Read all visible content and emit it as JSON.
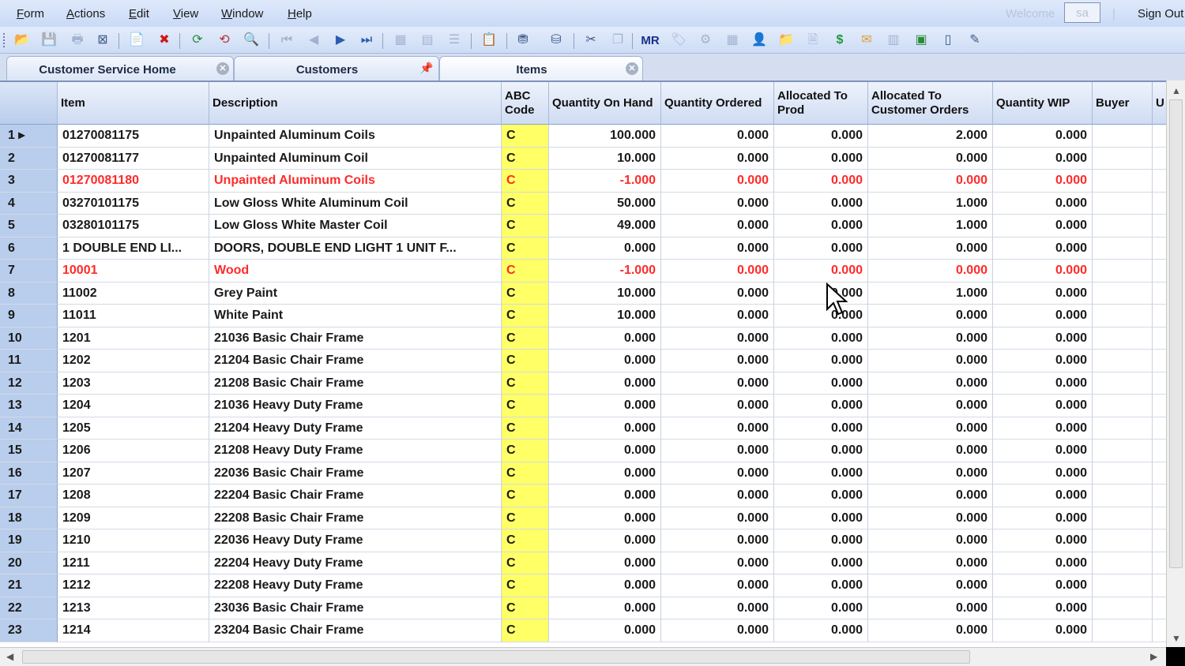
{
  "menu": [
    {
      "first": "F",
      "rest": "orm"
    },
    {
      "first": "A",
      "rest": "ctions"
    },
    {
      "first": "E",
      "rest": "dit"
    },
    {
      "first": "V",
      "rest": "iew"
    },
    {
      "first": "W",
      "rest": "indow"
    },
    {
      "first": "H",
      "rest": "elp"
    }
  ],
  "header": {
    "welcome": "Welcome",
    "user": "sa",
    "separator": "|",
    "sign_out": "Sign Out"
  },
  "toolbar_icons": [
    "open-folder-icon",
    "save-icon",
    "print-icon",
    "close-form-icon",
    "new-icon",
    "delete-icon",
    "refresh-icon",
    "refresh-current-icon",
    "find-icon",
    "first-record-icon",
    "prev-record-icon",
    "next-record-icon",
    "last-record-icon",
    "grid-view-icon",
    "form-view-icon",
    "list-view-icon",
    "report-icon",
    "filter-icon",
    "filter-in-place-icon",
    "tools-icon",
    "copy-icon",
    "mr-icon",
    "tag-icon",
    "gear-icon",
    "calculator-icon",
    "user-icon",
    "folder-icon",
    "document-icon",
    "dollar-icon",
    "mail-icon",
    "table-icon",
    "excel-icon",
    "blank-page-icon",
    "stamp-icon"
  ],
  "tabs": [
    {
      "label": "Customer Service Home"
    },
    {
      "label": "Customers"
    },
    {
      "label": "Items"
    }
  ],
  "columns": [
    "",
    "Item",
    "Description",
    "ABC Code",
    "Quantity On Hand",
    "Quantity Ordered",
    "Allocated To Prod",
    "Allocated To Customer Orders",
    "Quantity WIP",
    "Buyer",
    "U"
  ],
  "rows": [
    {
      "n": "1 ▸",
      "item": "01270081175",
      "desc": "Unpainted Aluminum Coils",
      "abc": "C",
      "qoh": "100.000",
      "qord": "0.000",
      "aprod": "0.000",
      "acust": "2.000",
      "wip": "0.000",
      "buyer": "",
      "red": false
    },
    {
      "n": "2",
      "item": "01270081177",
      "desc": "Unpainted Aluminum Coil",
      "abc": "C",
      "qoh": "10.000",
      "qord": "0.000",
      "aprod": "0.000",
      "acust": "0.000",
      "wip": "0.000",
      "buyer": "",
      "red": false
    },
    {
      "n": "3",
      "item": "01270081180",
      "desc": "Unpainted Aluminum Coils",
      "abc": "C",
      "qoh": "-1.000",
      "qord": "0.000",
      "aprod": "0.000",
      "acust": "0.000",
      "wip": "0.000",
      "buyer": "",
      "red": true
    },
    {
      "n": "4",
      "item": "03270101175",
      "desc": "Low Gloss White Aluminum Coil",
      "abc": "C",
      "qoh": "50.000",
      "qord": "0.000",
      "aprod": "0.000",
      "acust": "1.000",
      "wip": "0.000",
      "buyer": "",
      "red": false
    },
    {
      "n": "5",
      "item": "03280101175",
      "desc": "Low Gloss White Master Coil",
      "abc": "C",
      "qoh": "49.000",
      "qord": "0.000",
      "aprod": "0.000",
      "acust": "1.000",
      "wip": "0.000",
      "buyer": "",
      "red": false
    },
    {
      "n": "6",
      "item": "1 DOUBLE END LI...",
      "desc": "DOORS, DOUBLE END LIGHT 1 UNIT F...",
      "abc": "C",
      "qoh": "0.000",
      "qord": "0.000",
      "aprod": "0.000",
      "acust": "0.000",
      "wip": "0.000",
      "buyer": "",
      "red": false
    },
    {
      "n": "7",
      "item": "10001",
      "desc": "Wood",
      "abc": "C",
      "qoh": "-1.000",
      "qord": "0.000",
      "aprod": "0.000",
      "acust": "0.000",
      "wip": "0.000",
      "buyer": "",
      "red": true
    },
    {
      "n": "8",
      "item": "11002",
      "desc": "Grey Paint",
      "abc": "C",
      "qoh": "10.000",
      "qord": "0.000",
      "aprod": "0.000",
      "acust": "1.000",
      "wip": "0.000",
      "buyer": "",
      "red": false
    },
    {
      "n": "9",
      "item": "11011",
      "desc": "White Paint",
      "abc": "C",
      "qoh": "10.000",
      "qord": "0.000",
      "aprod": "0.000",
      "acust": "0.000",
      "wip": "0.000",
      "buyer": "",
      "red": false
    },
    {
      "n": "10",
      "item": "1201",
      "desc": "21036 Basic Chair Frame",
      "abc": "C",
      "qoh": "0.000",
      "qord": "0.000",
      "aprod": "0.000",
      "acust": "0.000",
      "wip": "0.000",
      "buyer": "",
      "red": false
    },
    {
      "n": "11",
      "item": "1202",
      "desc": "21204 Basic Chair Frame",
      "abc": "C",
      "qoh": "0.000",
      "qord": "0.000",
      "aprod": "0.000",
      "acust": "0.000",
      "wip": "0.000",
      "buyer": "",
      "red": false
    },
    {
      "n": "12",
      "item": "1203",
      "desc": "21208 Basic Chair Frame",
      "abc": "C",
      "qoh": "0.000",
      "qord": "0.000",
      "aprod": "0.000",
      "acust": "0.000",
      "wip": "0.000",
      "buyer": "",
      "red": false
    },
    {
      "n": "13",
      "item": "1204",
      "desc": "21036 Heavy Duty  Frame",
      "abc": "C",
      "qoh": "0.000",
      "qord": "0.000",
      "aprod": "0.000",
      "acust": "0.000",
      "wip": "0.000",
      "buyer": "",
      "red": false
    },
    {
      "n": "14",
      "item": "1205",
      "desc": "21204 Heavy Duty Frame",
      "abc": "C",
      "qoh": "0.000",
      "qord": "0.000",
      "aprod": "0.000",
      "acust": "0.000",
      "wip": "0.000",
      "buyer": "",
      "red": false
    },
    {
      "n": "15",
      "item": "1206",
      "desc": "21208 Heavy Duty Frame",
      "abc": "C",
      "qoh": "0.000",
      "qord": "0.000",
      "aprod": "0.000",
      "acust": "0.000",
      "wip": "0.000",
      "buyer": "",
      "red": false
    },
    {
      "n": "16",
      "item": "1207",
      "desc": "22036 Basic Chair Frame",
      "abc": "C",
      "qoh": "0.000",
      "qord": "0.000",
      "aprod": "0.000",
      "acust": "0.000",
      "wip": "0.000",
      "buyer": "",
      "red": false
    },
    {
      "n": "17",
      "item": "1208",
      "desc": "22204 Basic Chair Frame",
      "abc": "C",
      "qoh": "0.000",
      "qord": "0.000",
      "aprod": "0.000",
      "acust": "0.000",
      "wip": "0.000",
      "buyer": "",
      "red": false
    },
    {
      "n": "18",
      "item": "1209",
      "desc": "22208 Basic Chair Frame",
      "abc": "C",
      "qoh": "0.000",
      "qord": "0.000",
      "aprod": "0.000",
      "acust": "0.000",
      "wip": "0.000",
      "buyer": "",
      "red": false
    },
    {
      "n": "19",
      "item": "1210",
      "desc": "22036 Heavy Duty  Frame",
      "abc": "C",
      "qoh": "0.000",
      "qord": "0.000",
      "aprod": "0.000",
      "acust": "0.000",
      "wip": "0.000",
      "buyer": "",
      "red": false
    },
    {
      "n": "20",
      "item": "1211",
      "desc": "22204 Heavy Duty Frame",
      "abc": "C",
      "qoh": "0.000",
      "qord": "0.000",
      "aprod": "0.000",
      "acust": "0.000",
      "wip": "0.000",
      "buyer": "",
      "red": false
    },
    {
      "n": "21",
      "item": "1212",
      "desc": "22208 Heavy Duty Frame",
      "abc": "C",
      "qoh": "0.000",
      "qord": "0.000",
      "aprod": "0.000",
      "acust": "0.000",
      "wip": "0.000",
      "buyer": "",
      "red": false
    },
    {
      "n": "22",
      "item": "1213",
      "desc": "23036 Basic Chair Frame",
      "abc": "C",
      "qoh": "0.000",
      "qord": "0.000",
      "aprod": "0.000",
      "acust": "0.000",
      "wip": "0.000",
      "buyer": "",
      "red": false
    },
    {
      "n": "23",
      "item": "1214",
      "desc": "23204 Basic Chair Frame",
      "abc": "C",
      "qoh": "0.000",
      "qord": "0.000",
      "aprod": "0.000",
      "acust": "0.000",
      "wip": "0.000",
      "buyer": "",
      "red": false
    }
  ],
  "colors": {
    "abc_highlight": "#ffff66",
    "negative_row": "#ff2a2a",
    "row_header": "#b9cdec"
  }
}
